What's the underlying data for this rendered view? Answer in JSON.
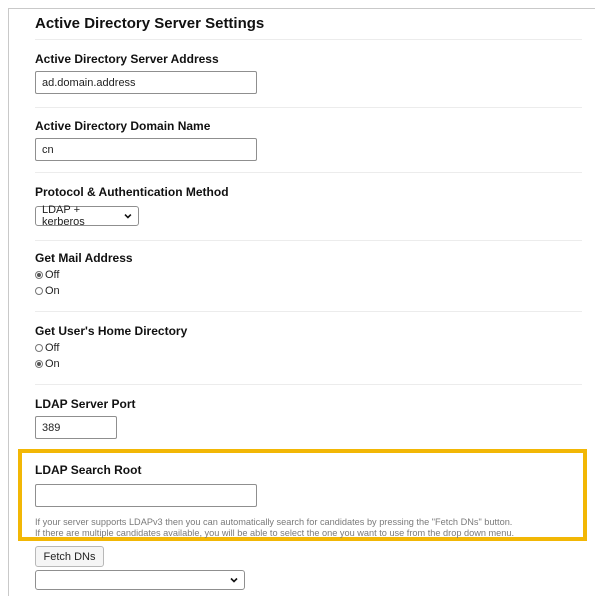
{
  "section_title": "Active Directory Server Settings",
  "server_address": {
    "label": "Active Directory Server Address",
    "value": "ad.domain.address"
  },
  "domain_name": {
    "label": "Active Directory Domain Name",
    "value": "cn"
  },
  "protocol": {
    "label": "Protocol & Authentication Method",
    "selected": "LDAP + kerberos"
  },
  "get_mail_address": {
    "label": "Get Mail Address",
    "options": [
      {
        "label": "Off",
        "checked": true
      },
      {
        "label": "On",
        "checked": false
      }
    ]
  },
  "get_home_directory": {
    "label": "Get User's Home Directory",
    "options": [
      {
        "label": "Off",
        "checked": false
      },
      {
        "label": "On",
        "checked": true
      }
    ]
  },
  "ldap_port": {
    "label": "LDAP Server Port",
    "value": "389"
  },
  "ldap_search_root": {
    "label": "LDAP Search Root",
    "value": "",
    "help_line1": "If your server supports LDAPv3 then you can automatically search for candidates by pressing the \"Fetch DNs\" button.",
    "help_line2": "If there are multiple candidates available, you will be able to select the one you want to use from the drop down menu."
  },
  "fetch_button": {
    "label": "Fetch DNs"
  },
  "dn_select": {
    "selected": ""
  },
  "colors": {
    "highlight": "#f2b705"
  }
}
